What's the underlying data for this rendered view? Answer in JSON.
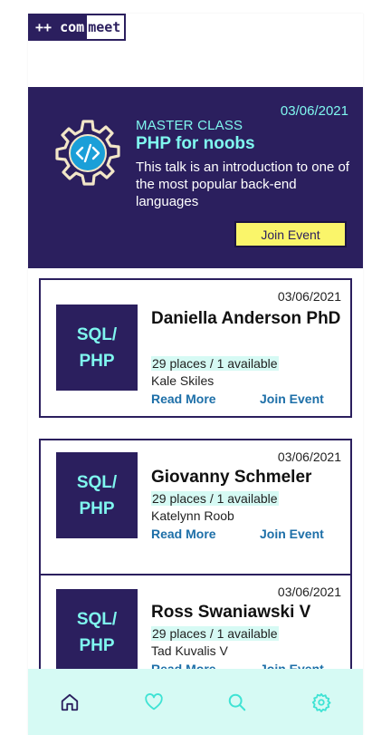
{
  "logo": {
    "part1": "++ com",
    "part2": "meet"
  },
  "hero": {
    "date": "03/06/2021",
    "kicker": "MASTER CLASS",
    "title": "PHP for noobs",
    "description": "This talk is an introduction to one of the most popular back-end languages",
    "button_label": "Join Event",
    "icon": "code-gear-icon"
  },
  "cards": [
    {
      "date": "03/06/2021",
      "thumb_line1": "SQL/",
      "thumb_line2": "PHP",
      "name": "Daniella Anderson PhD",
      "places": "29 places / 1 available",
      "author": "Kale Skiles",
      "read_more": "Read More",
      "join": "Join Event"
    },
    {
      "date": "03/06/2021",
      "thumb_line1": "SQL/",
      "thumb_line2": "PHP",
      "name": "Giovanny Schmeler",
      "places": "29 places / 1 available",
      "author": "Katelynn Roob",
      "read_more": "Read More",
      "join": "Join Event"
    },
    {
      "date": "03/06/2021",
      "thumb_line1": "SQL/",
      "thumb_line2": "PHP",
      "name": "Ross Swaniawski V",
      "places": "29 places / 1 available",
      "author": "Tad Kuvalis V",
      "read_more": "Read More",
      "join": "Join Event"
    }
  ],
  "nav": {
    "items": [
      "home-icon",
      "heart-icon",
      "search-icon",
      "settings-icon"
    ],
    "active": "home-icon"
  },
  "colors": {
    "primary": "#2b1f5e",
    "accent": "#7ff7ef",
    "button": "#faf56a",
    "link": "#1d6fa8",
    "nav_bg": "#d6faf4"
  }
}
